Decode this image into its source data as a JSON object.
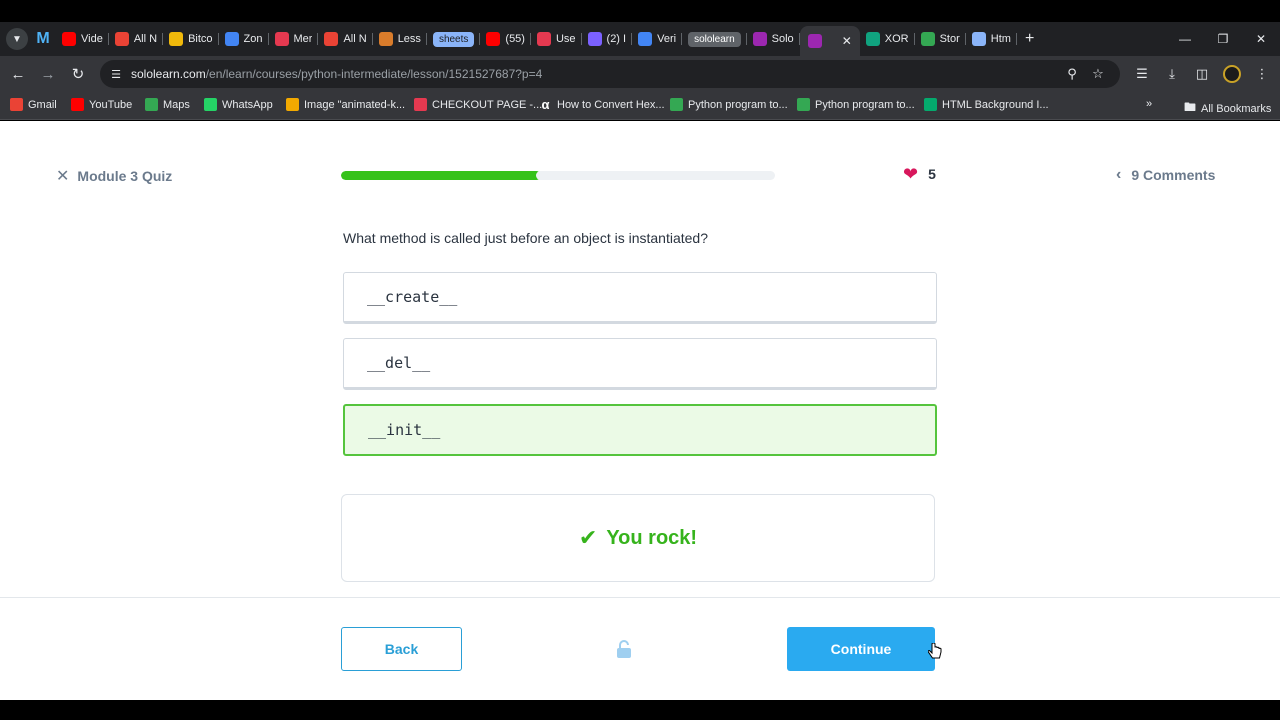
{
  "browser": {
    "tabs": [
      {
        "label": "Vide",
        "icon": "youtube-icon",
        "color": "#ff0000"
      },
      {
        "label": "All N",
        "icon": "gmail-icon",
        "color": "#ea4335"
      },
      {
        "label": "Bitco",
        "icon": "binance-icon",
        "color": "#f0b90b"
      },
      {
        "label": "Zon",
        "icon": "zon-icon",
        "color": "#4285f4"
      },
      {
        "label": "Mer",
        "icon": "mer-icon",
        "color": "#e53950"
      },
      {
        "label": "All N",
        "icon": "gmail-icon",
        "color": "#ea4335"
      },
      {
        "label": "Less",
        "icon": "lesson-icon",
        "color": "#d97c2b"
      },
      {
        "label": "sheets",
        "icon": "",
        "color": "#8ab4f8"
      },
      {
        "label": "(55)",
        "icon": "youtube-icon",
        "color": "#ff0000"
      },
      {
        "label": "Use",
        "icon": "use-icon",
        "color": "#e53950"
      },
      {
        "label": "(2) I",
        "icon": "chat-icon",
        "color": "#7b61ff"
      },
      {
        "label": "Veri",
        "icon": "pen-icon",
        "color": "#4285f4"
      },
      {
        "label": "sololearn",
        "icon": "",
        "color": "#5f6368"
      },
      {
        "label": "Solo",
        "icon": "sololearn-icon",
        "color": "#9c27b0"
      },
      {
        "label": "",
        "icon": "sololearn-icon",
        "color": "#9c27b0"
      },
      {
        "label": "XOR",
        "icon": "openai-icon",
        "color": "#10a37f"
      },
      {
        "label": "Stor",
        "icon": "drive-icon",
        "color": "#34a853"
      },
      {
        "label": "Htm",
        "icon": "moon-icon",
        "color": "#8ab4f8"
      }
    ],
    "url_host": "sololearn.com",
    "url_path": "/en/learn/courses/python-intermediate/lesson/1521527687?p=4",
    "bookmarks": [
      {
        "label": "Gmail",
        "icon": "gmail-icon",
        "color": "#ea4335"
      },
      {
        "label": "YouTube",
        "icon": "youtube-icon",
        "color": "#ff0000"
      },
      {
        "label": "Maps",
        "icon": "maps-icon",
        "color": "#34a853"
      },
      {
        "label": "WhatsApp",
        "icon": "whatsapp-icon",
        "color": "#25d366"
      },
      {
        "label": "Image \"animated-k...",
        "icon": "star-icon",
        "color": "#f2a900"
      },
      {
        "label": "CHECKOUT PAGE -...",
        "icon": "checkout-icon",
        "color": "#e53950"
      },
      {
        "label": "How to Convert Hex...",
        "icon": "alpha-icon",
        "color": "#ffffff"
      },
      {
        "label": "Python program to...",
        "icon": "python-icon",
        "color": "#34a853"
      },
      {
        "label": "Python program to...",
        "icon": "python-icon",
        "color": "#34a853"
      },
      {
        "label": "HTML Background I...",
        "icon": "w-icon",
        "color": "#04aa6d"
      }
    ],
    "all_bookmarks_label": "All Bookmarks"
  },
  "quiz": {
    "title": "Module 3 Quiz",
    "progress_fraction": 0.46,
    "hearts": "5",
    "comments_label": "9 Comments",
    "question": "What method is called just before an object is instantiated?",
    "options": [
      "__create__",
      "__del__",
      "__init__"
    ],
    "correct_index": 2,
    "feedback": "You rock!",
    "back_label": "Back",
    "continue_label": "Continue"
  },
  "colors": {
    "accent": "#2aaaf0",
    "success": "#36b31c",
    "heart": "#d8175c"
  }
}
